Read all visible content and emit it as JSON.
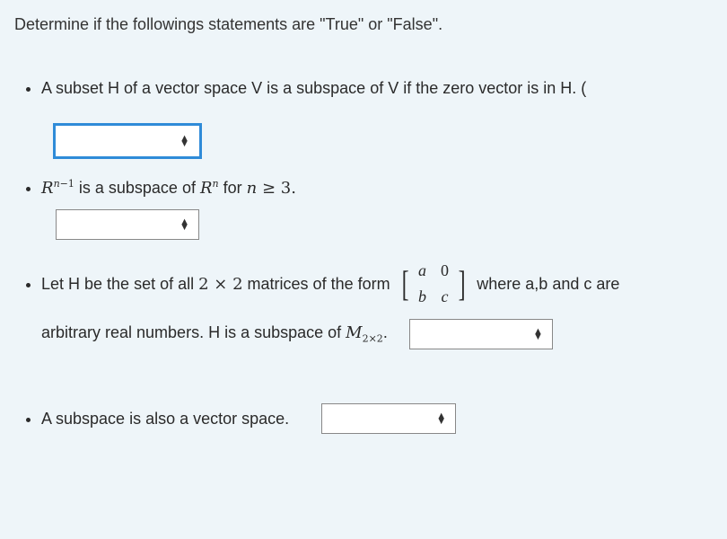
{
  "instruction": "Determine if the followings statements are \"True\" or \"False\".",
  "q1": {
    "text": "A subset H of a vector space V is a subspace of V if the zero vector is in H. ("
  },
  "q2": {
    "pre": "R",
    "exp1_a": "n",
    "exp1_b": "−1",
    "mid": " is a subspace of ",
    "r2": "R",
    "exp2": "n",
    "post": " for ",
    "nvar": "n",
    "geq": " ≥ 3."
  },
  "q3": {
    "t1a": "Let H be the set of all ",
    "dim": "2 × 2",
    "t1b": "  matrices of the form",
    "m": {
      "a": "a",
      "z": "0",
      "b": "b",
      "c": "c"
    },
    "t1c": " where a,b and c are",
    "t2a": "arbitrary real numbers. H is a subspace of ",
    "Msym": "M",
    "Msub": "2×2",
    "t2b": "."
  },
  "q4": {
    "text": "A subspace is also a vector space."
  }
}
